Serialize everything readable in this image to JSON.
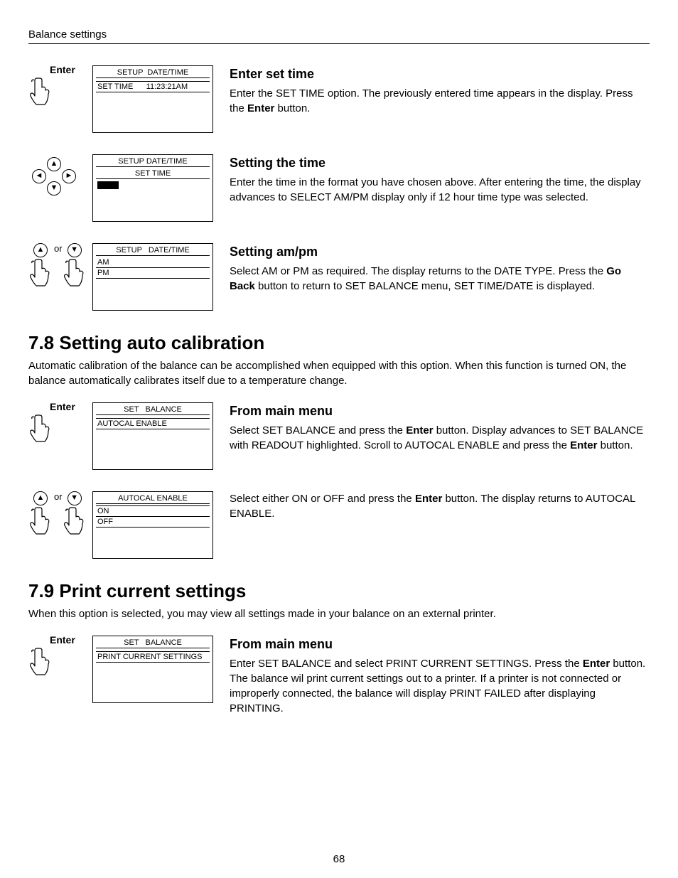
{
  "header": "Balance settings",
  "page_number": "68",
  "steps": [
    {
      "icon_label": "Enter",
      "lcd": {
        "title": "SETUP  DATE/TIME",
        "lines": [
          "",
          "SET TIME      11:23:21AM"
        ]
      },
      "heading": "Enter set time",
      "body_pre": "Enter the SET TIME option. The previously entered time appears in the display.  Press the ",
      "body_bold": "Enter",
      "body_post": " button."
    },
    {
      "icon_label": "",
      "lcd": {
        "title": "SETUP DATE/TIME",
        "subtitle": "SET TIME",
        "cursor": true
      },
      "heading": "Setting the time",
      "body": "Enter the time in the format you have chosen above.   After entering the time, the display advances to SELECT AM/PM display only if 12 hour time type was selected."
    },
    {
      "icon_label": "or",
      "lcd": {
        "title": "SETUP   DATE/TIME",
        "lines": [
          "AM",
          "PM"
        ],
        "hr_after": 1
      },
      "heading": "Setting am/pm",
      "body_pre": "Select AM or PM as required.  The display returns to the DATE TYPE.  Press the ",
      "body_bold": "Go Back",
      "body_post": " button to return to SET BALANCE menu, SET TIME/DATE is displayed."
    }
  ],
  "section78": {
    "title": "7.8   Setting auto calibration",
    "intro": "Automatic calibration of the balance can be accomplished when equipped with this option.  When this function is turned ON, the balance automatically calibrates itself due to a temperature change.",
    "stepA": {
      "icon_label": "Enter",
      "lcd": {
        "title": "SET   BALANCE",
        "lines": [
          "",
          "AUTOCAL ENABLE"
        ],
        "hr_after": 2
      },
      "heading": "From main menu",
      "body_1a": "Select SET BALANCE and press the ",
      "body_1b": "Enter",
      "body_1c": " button.  Display advances to SET BALANCE with READOUT highlighted.  Scroll to AUTOCAL ENABLE  and press the ",
      "body_1d": "Enter",
      "body_1e": " button."
    },
    "stepB": {
      "icon_label": "or",
      "lcd": {
        "title": "AUTOCAL ENABLE",
        "lines": [
          "ON",
          "OFF"
        ],
        "hr_after": 1
      },
      "body_pre": "Select either ON or OFF and press the ",
      "body_bold": "Enter",
      "body_post": " button.  The display returns to AUTOCAL ENABLE."
    }
  },
  "section79": {
    "title": "7.9  Print current settings",
    "intro": "When this option is selected, you may view all settings made in your balance on an external printer.",
    "step": {
      "icon_label": "Enter",
      "lcd": {
        "title": "SET   BALANCE",
        "lines": [
          "",
          "PRINT CURRENT SETTINGS"
        ],
        "hr_after": 2
      },
      "heading": "From main menu",
      "body_pre": "Enter SET BALANCE and select PRINT CURRENT SETTINGS.  Press the ",
      "body_bold": "Enter",
      "body_post": " button.  The balance wil print current settings out to a printer.  If a printer is not connected or improperly connected, the balance will display PRINT FAILED after displaying PRINTING."
    }
  }
}
